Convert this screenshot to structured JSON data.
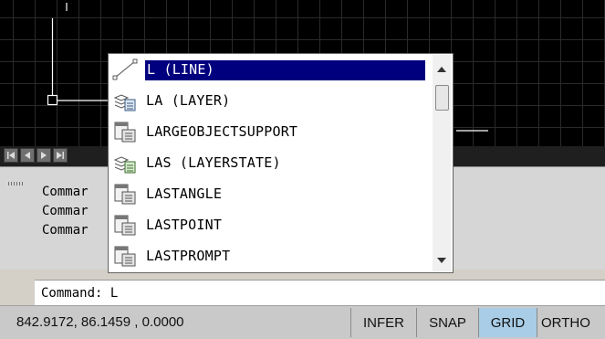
{
  "autocomplete": {
    "items": [
      {
        "label": "L (LINE)",
        "icon": "line-icon",
        "selected": true
      },
      {
        "label": "LA (LAYER)",
        "icon": "layer-icon",
        "selected": false
      },
      {
        "label": "LARGEOBJECTSUPPORT",
        "icon": "system-variable-icon",
        "selected": false
      },
      {
        "label": "LAS (LAYERSTATE)",
        "icon": "layer-state-icon",
        "selected": false
      },
      {
        "label": "LASTANGLE",
        "icon": "system-variable-icon",
        "selected": false
      },
      {
        "label": "LASTPOINT",
        "icon": "system-variable-icon",
        "selected": false
      },
      {
        "label": "LASTPROMPT",
        "icon": "system-variable-icon",
        "selected": false
      }
    ],
    "scroll_position": 0.0
  },
  "command_history": [
    "Commar",
    "Commar",
    "Commar"
  ],
  "command_line": {
    "value": "Command: L"
  },
  "status_bar": {
    "coordinates": "842.9172, 86.1459 , 0.0000",
    "toggles": [
      {
        "label": "INFER",
        "active": false
      },
      {
        "label": "SNAP",
        "active": false
      },
      {
        "label": "GRID",
        "active": true
      },
      {
        "label": "ORTHO",
        "active": false
      }
    ]
  },
  "colors": {
    "canvas": "#000000",
    "grid": "#2a2a2a",
    "selection": "#00007f",
    "toggle_active": "#a9cde6"
  }
}
